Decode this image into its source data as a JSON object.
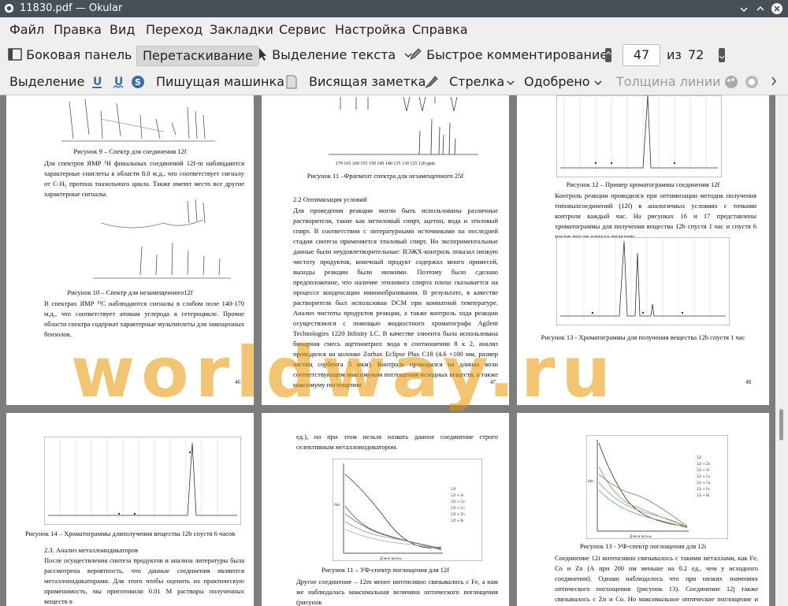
{
  "window": {
    "title": "11830.pdf  — Okular"
  },
  "menu": {
    "file": "Файл",
    "edit": "Правка",
    "view": "Вид",
    "go": "Переход",
    "bookmarks": "Закладки",
    "tools": "Сервис",
    "settings": "Настройка",
    "help": "Справка"
  },
  "toolbar": {
    "sidebar": "Боковая панель",
    "browse": "Перетаскивание",
    "text_select": "Выделение текста",
    "quick_annot": "Быстрое комментирование",
    "page_current": "47",
    "page_of": "из",
    "page_total": "72"
  },
  "annot_bar": {
    "highlight": "Выделение",
    "typewriter": "Пишущая машинка",
    "popup_note": "Висящая заметка",
    "arrow": "Стрелка",
    "stamp": "Одобрено",
    "line_width": "Толщина линии"
  },
  "watermark": "worldway.ru",
  "pages": {
    "p46": {
      "cap9": "Рисунок 9 – Спектр для соединения 12f",
      "para1": "Для спектров ЯМР ¹H финальных соединений 12f-m наблюдаются характерные синглеты в области 8.0 м.д., что соответствует сигналу от C-H₅ протона тиазольного цикла. Также имеют место все другие характерные сигналы.",
      "cap10": "Рисунок 10 – Спектр для незамещенного12f",
      "para2": "В спектрах ЯМР ¹³C наблюдаются сигналы в слабом поле 140-170 м.д., что соответствует атомам углерода в гетероцикле. Прочие области спектра содержат характерные мультиплеты для замещенных бензолов.",
      "num": "46"
    },
    "p47": {
      "ticks": "170  165  160  155  150  145  140  135  130  125  120  ppm",
      "cap11": "Рисунок 11 –Фрагмент спектра для незамещенного 25f",
      "heading": "2.2  Оптимизация условий",
      "para": "Для проведения реакции могли быть использованы различные растворители, такие как метиловый спирт, ацетон, вода и этиловый спирт. В соответствии с литературными источниками на последней стадии синтеза применяется этиловый спирт. Но экспериментальные данные были неудовлетворительные: ВЭЖХ-контроль показал низкую чистоту продуктов, конечный продукт содержал много примесей, выходы реакции были низкими. Поэтому было сделано предположение, что наличие этилового спирта плохо сказывается на процессе конденсации иминообразования. В результате, в качестве растворителя был использован DCM при комнатной температуре. Анализ чистоты продуктов реакции, а также контроль хода реакции осуществлялся с помощью жидкостного хроматографа Agilent Technologies 1220 Infinity LC. В качестве элюента была использована бинарная смесь ацетонитрил: вода в соотношении 8 к 2, анализ проводился на колонке Zorbax Eclipse Plus C18 (4.6 ×100 мм, размер частиц сорбента 5 мкм). Контроль проводился на длинах волн соответствующим максимумам поглощения исходных веществ, а также максимуму поглощения",
      "num": "47"
    },
    "p48": {
      "cap12": "Рисунок 12 – Пример хроматограммы соединения 12f",
      "para": "Контроль реакции проводился при оптимизации методик получения типовыхсоединений (12f) в аналогичных условиях с точками контроля каждый час. На рисунках 16 и 17 представлены хроматограммы для получения вещества 12b спустя 1 час и спустя 6 часов после начала реакции.",
      "cap13": "Рисунок 13 - Хроматограммы для получения вещества 12b спустя 1 час",
      "num": "48"
    },
    "p49": {
      "cap14": "Рисунок 14 – Хроматограммы дляполучения вещества 12b спустя 6 часов",
      "heading": "2.3. Анализ металлоиндикаторов",
      "para": "После осуществления синтеза продуктов и анализа литературы была рассмотрена вероятность, что данные соединения являются металлоиндикаторами. Для этого чтобы оценить их практическую применимость, мы приготовили 0.01 М растворы полученных веществ в"
    },
    "p50": {
      "top": "ед.), но при этом нельзя назвать данное соединение строго селективным металлоиндикатором.",
      "legend": [
        "12f",
        "12f + Al",
        "12f + Co",
        "12f + Cu",
        "12f + Zn",
        "12f + Ni"
      ],
      "ylabel": "Abs",
      "xlabel": "Длина волны",
      "cap11b": "Рисунок 11 – УФ-спектр поглощения для 12f",
      "para": "Другое соединение – 12m менее интенсивно связывалось с Fe, а нам же наблюдалась максимальная величина оптического поглощения (рисунок"
    },
    "p51": {
      "legend": [
        "12i",
        "12i + Zn",
        "12i + Al",
        "12i + Cu",
        "12i + Co",
        "12i + Fe",
        "12i + Ni"
      ],
      "ylabel": "Abs",
      "xlabel": "Длина волны",
      "cap13b": "Рисунок 13 - УФ-спектр поглощения для 12i",
      "para": "Соединение 12i интенсивно связывалось с такими металлами, как Fe, Co и Zn (А при 200 нм меньше на 0.2 ед., чем у исходного соединения). Однако наблюдалось что при низких значениях оптического поглощения (рисунок 13). Соединение 12j также связывалось с Zn и Co. Но максимальное оптическое поглощение и связывание наблюдалось именно для железа"
    }
  },
  "colors": {
    "titlebar": "#475057",
    "viewport": "#7d7d7d",
    "watermark": "#e69600"
  }
}
